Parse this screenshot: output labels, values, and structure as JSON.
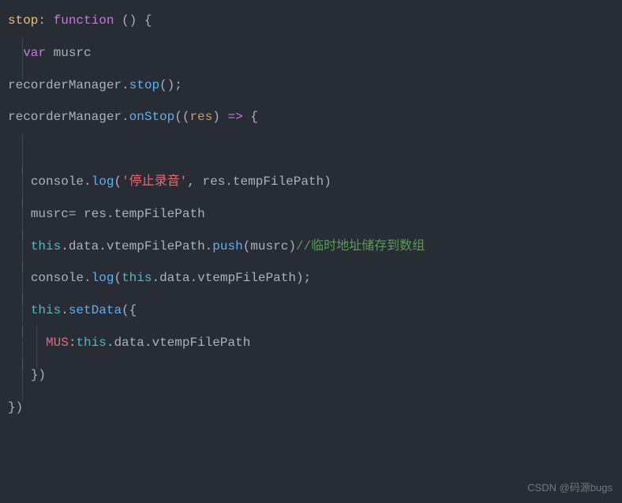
{
  "code": {
    "line1": {
      "prop": "stop",
      "colon": ": ",
      "func_kw": "function ",
      "parens": "() ",
      "brace": "{"
    },
    "line2": {
      "indent": "  ",
      "var_kw": "var ",
      "var_name": "musrc"
    },
    "line3": {
      "obj": "recorderManager",
      "dot": ".",
      "method": "stop",
      "tail": "();"
    },
    "line4": {
      "obj": "recorderManager",
      "dot1": ".",
      "method": "onStop",
      "open": "((",
      "param": "res",
      "close": ") ",
      "arrow": "=> ",
      "brace": "{"
    },
    "line5": {
      "indent": "   ",
      "console": "console",
      "dot": ".",
      "log": "log",
      "open": "(",
      "str": "'停止录音'",
      "comma": ", ",
      "res": "res",
      "dot2": ".",
      "prop": "tempFilePath",
      "close": ")"
    },
    "line6": {
      "indent": "   ",
      "var": "musrc",
      "assign": "= ",
      "res": "res",
      "dot": ".",
      "prop": "tempFilePath"
    },
    "line7": {
      "indent": "   ",
      "this": "this",
      "dot1": ".",
      "data": "data",
      "dot2": ".",
      "vtemp": "vtempFilePath",
      "dot3": ".",
      "push": "push",
      "open": "(",
      "arg": "musrc",
      "close": ")",
      "comment": "//临时地址储存到数组"
    },
    "line8": {
      "indent": "   ",
      "console": "console",
      "dot": ".",
      "log": "log",
      "open": "(",
      "this": "this",
      "dot2": ".",
      "data": "data",
      "dot3": ".",
      "vtemp": "vtempFilePath",
      "close": ");"
    },
    "line9": {
      "indent": "   ",
      "this": "this",
      "dot": ".",
      "setdata": "setData",
      "tail": "({"
    },
    "line10": {
      "indent": "     ",
      "key": "MUS",
      "colon": ":",
      "this": "this",
      "dot1": ".",
      "data": "data",
      "dot2": ".",
      "vtemp": "vtempFilePath"
    },
    "line11": {
      "indent": "   ",
      "tail": "})"
    },
    "line12": {
      "tail": "})"
    }
  },
  "watermark": "CSDN @码源bugs"
}
